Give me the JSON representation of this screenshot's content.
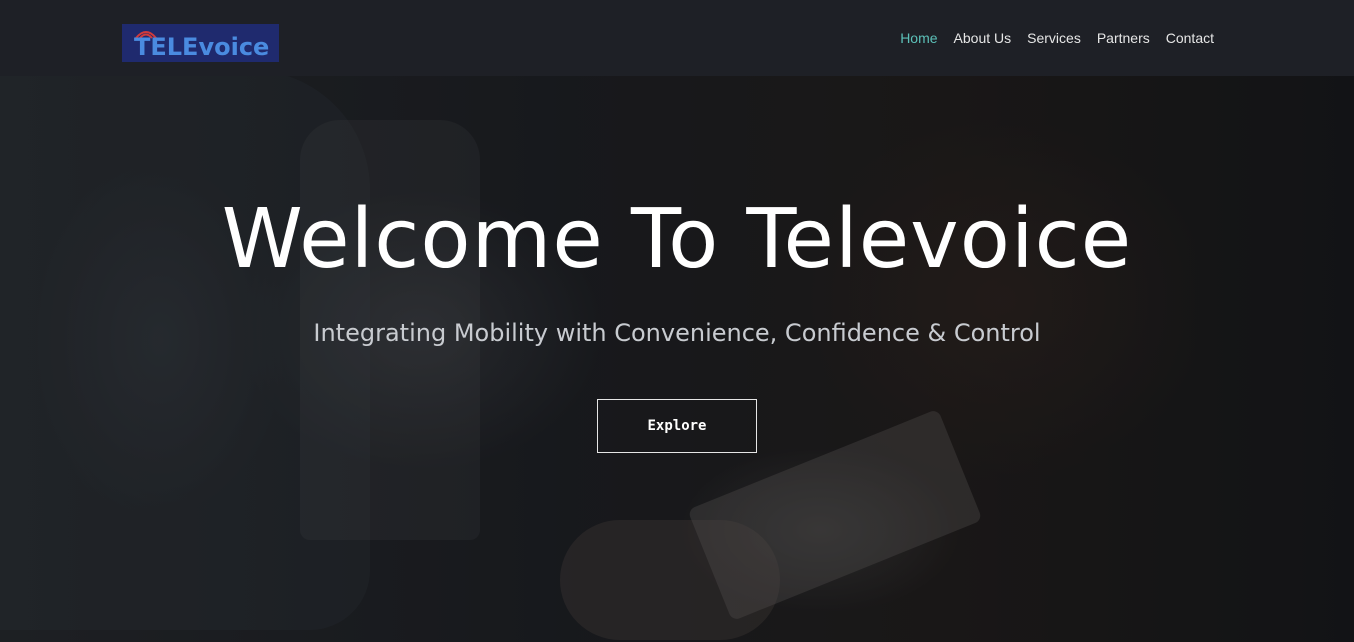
{
  "header": {
    "logo_text": "TELEvoice",
    "logo_icon": "signal-waves-icon",
    "nav": [
      {
        "label": "Home",
        "active": true
      },
      {
        "label": "About Us",
        "active": false
      },
      {
        "label": "Services",
        "active": false
      },
      {
        "label": "Partners",
        "active": false
      },
      {
        "label": "Contact",
        "active": false
      }
    ]
  },
  "hero": {
    "title": "Welcome To Televoice",
    "subtitle": "Integrating Mobility with Convenience, Confidence & Control",
    "cta_label": "Explore"
  },
  "colors": {
    "header_bg": "#1e2026",
    "nav_active": "#5cc0b8",
    "nav_text": "#e6e6e6",
    "logo_bg": "#1f2a6e",
    "logo_text": "#4a8be0"
  }
}
